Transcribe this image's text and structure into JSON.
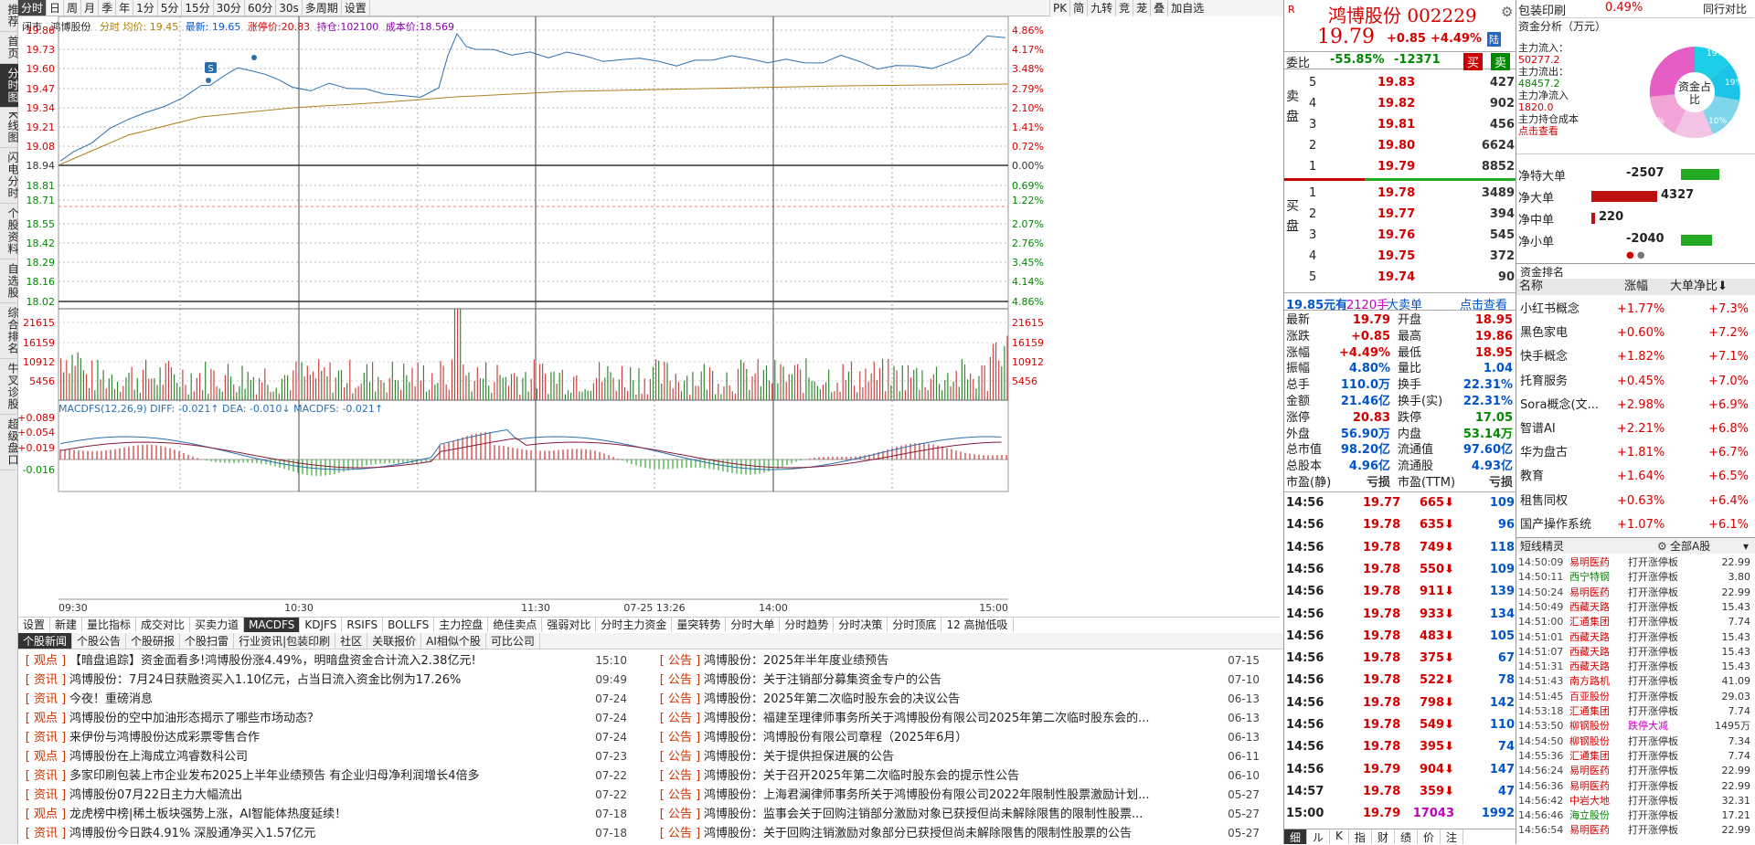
{
  "left_sidebar": [
    "推荐",
    "首页",
    "分时图",
    "K线图",
    "闪电分时",
    "个股资料",
    "自选股",
    "综合排名",
    "牛叉诊股",
    "超级盘口"
  ],
  "toolbar": [
    "分时",
    "日",
    "周",
    "月",
    "季",
    "年",
    "1分",
    "5分",
    "15分",
    "30分",
    "60分",
    "30s",
    "多周期",
    "设置"
  ],
  "toolbar_right": [
    "PK",
    "简",
    "九转",
    "竞",
    "茏",
    "叠",
    "加自选"
  ],
  "info": {
    "status": "闭市",
    "name": "鸿博股份",
    "avg": "分时 均价: 19.45",
    "latest": "最新: 19.65",
    "limit": "涨停价:20.83",
    "hold": "持仓:102100",
    "cost": "成本价:18.569"
  },
  "price_axis": {
    "left": [
      "19.86",
      "19.73",
      "19.60",
      "19.47",
      "19.34",
      "19.21",
      "19.08",
      "18.94",
      "18.81",
      "18.71",
      "18.55",
      "18.42",
      "18.29",
      "18.16",
      "18.02"
    ],
    "right": [
      "4.86%",
      "4.17%",
      "3.48%",
      "2.79%",
      "2.10%",
      "1.41%",
      "0.72%",
      "0.00%",
      "0.69%",
      "1.22%",
      "2.07%",
      "2.76%",
      "3.45%",
      "4.14%",
      "4.86%"
    ]
  },
  "volume_axis": [
    "21615",
    "16159",
    "10912",
    "5456"
  ],
  "macd": {
    "legend": "MACDFS(12,26,9) DIFF: -0.021↑ DEA: -0.010↓ MACDFS: -0.021↑",
    "ticks": [
      "+0.089",
      "+0.054",
      "+0.019",
      "-0.016"
    ]
  },
  "time_axis": [
    "09:30",
    "10:30",
    "11:30",
    "07-25 13:26",
    "14:00",
    "15:00"
  ],
  "badge": "S",
  "bottom_tabs": [
    "设置",
    "新建",
    "量比指标",
    "成交对比",
    "买卖力道",
    "MACDFS",
    "KDJFS",
    "RSIFS",
    "BOLLFS",
    "主力控盘",
    "绝佳卖点",
    "强弱对比",
    "分时主力资金",
    "量突转势",
    "分时大单",
    "分时趋势",
    "分时决策",
    "分时顶底",
    "12 高抛低吸"
  ],
  "news_tabs": [
    "个股新闻",
    "个股公告",
    "个股研报",
    "个股扫雷",
    "行业资讯|包装印刷",
    "社区",
    "关联报价",
    "AI相似个股",
    "可比公司"
  ],
  "news_left": [
    {
      "tag": "观点",
      "title": "【暗盘追踪】资金面看多!鸿博股份涨4.49%，明暗盘资金合计流入2.38亿元!",
      "date": "15:10"
    },
    {
      "tag": "资讯",
      "title": "鸿博股份：7月24日获融资买入1.10亿元，占当日流入资金比例为17.26%",
      "date": "09:49"
    },
    {
      "tag": "资讯",
      "title": "今夜！重磅消息",
      "date": "07-24"
    },
    {
      "tag": "观点",
      "title": "鸿博股份的空中加油形态揭示了哪些市场动态？",
      "date": "07-24"
    },
    {
      "tag": "资讯",
      "title": "来伊份与鸿博股份达成彩票零售合作",
      "date": "07-24"
    },
    {
      "tag": "观点",
      "title": "鸿博股份在上海成立鸿睿数科公司",
      "date": "07-23"
    },
    {
      "tag": "资讯",
      "title": "多家印刷包装上市企业发布2025上半年业绩预告 有企业归母净利润增长4倍多",
      "date": "07-22"
    },
    {
      "tag": "资讯",
      "title": "鸿博股份07月22日主力大幅流出",
      "date": "07-22"
    },
    {
      "tag": "观点",
      "title": "龙虎榜中榜|稀土板块强势上涨，AI智能体热度延续！",
      "date": "07-18"
    },
    {
      "tag": "资讯",
      "title": "鸿博股份今日跌4.91% 深股通净买入1.57亿元",
      "date": "07-18"
    }
  ],
  "news_right": [
    {
      "tag": "公告",
      "title": "鸿博股份：2025年半年度业绩预告",
      "date": "07-15"
    },
    {
      "tag": "公告",
      "title": "鸿博股份：关于注销部分募集资金专户的公告",
      "date": "07-10"
    },
    {
      "tag": "公告",
      "title": "鸿博股份：2025年第二次临时股东会的决议公告",
      "date": "06-13"
    },
    {
      "tag": "公告",
      "title": "鸿博股份：福建至理律师事务所关于鸿博股份有限公司2025年第二次临时股东会的...",
      "date": "06-13"
    },
    {
      "tag": "公告",
      "title": "鸿博股份：鸿博股份有限公司章程（2025年6月）",
      "date": "06-13"
    },
    {
      "tag": "公告",
      "title": "鸿博股份：关于提供担保进展的公告",
      "date": "06-11"
    },
    {
      "tag": "公告",
      "title": "鸿博股份：关于召开2025年第二次临时股东会的提示性公告",
      "date": "06-10"
    },
    {
      "tag": "公告",
      "title": "鸿博股份：上海君澜律师事务所关于鸿博股份有限公司2022年限制性股票激励计划...",
      "date": "05-27"
    },
    {
      "tag": "公告",
      "title": "鸿博股份：监事会关于回购注销部分激励对象已获授但尚未解除限售的限制性股票...",
      "date": "05-27"
    },
    {
      "tag": "公告",
      "title": "鸿博股份：关于回购注销激励对象部分已获授但尚未解除限售的限制性股票的公告",
      "date": "05-27"
    }
  ],
  "quote": {
    "r": "R",
    "name": "鸿博股份 002229",
    "price": "19.79",
    "change": "+0.85",
    "pct": "+4.49%",
    "lu": "陆",
    "weibi_label": "委比",
    "weibi": "-55.85%",
    "weicha": "-12371",
    "buy": "买",
    "sell": "卖",
    "sell_label": "卖盘",
    "buy_label": "买盘"
  },
  "asks": [
    {
      "l": "5",
      "p": "19.83",
      "v": "427"
    },
    {
      "l": "4",
      "p": "19.82",
      "v": "902"
    },
    {
      "l": "3",
      "p": "19.81",
      "v": "456"
    },
    {
      "l": "2",
      "p": "19.80",
      "v": "6624"
    },
    {
      "l": "1",
      "p": "19.79",
      "v": "8852"
    }
  ],
  "bids": [
    {
      "l": "1",
      "p": "19.78",
      "v": "3489"
    },
    {
      "l": "2",
      "p": "19.77",
      "v": "394"
    },
    {
      "l": "3",
      "p": "19.76",
      "v": "545"
    },
    {
      "l": "4",
      "p": "19.75",
      "v": "372"
    },
    {
      "l": "5",
      "p": "19.74",
      "v": "90"
    }
  ],
  "bigorder": {
    "price": "19.85元有",
    "hands": "2120手",
    "label": "大卖单",
    "link": "点击查看"
  },
  "stats": [
    [
      "最新",
      "19.79",
      "开盘",
      "18.95"
    ],
    [
      "涨跌",
      "+0.85",
      "最高",
      "19.86"
    ],
    [
      "涨幅",
      "+4.49%",
      "最低",
      "18.95"
    ],
    [
      "振幅",
      "4.80%",
      "量比",
      "1.04"
    ],
    [
      "总手",
      "110.0万",
      "换手",
      "22.31%"
    ],
    [
      "金额",
      "21.46亿",
      "换手(实)",
      "22.31%"
    ],
    [
      "涨停",
      "20.83",
      "跌停",
      "17.05"
    ],
    [
      "外盘",
      "56.90万",
      "内盘",
      "53.14万"
    ],
    [
      "总市值",
      "98.20亿",
      "流通值",
      "97.60亿"
    ],
    [
      "总股本",
      "4.96亿",
      "流通股",
      "4.93亿"
    ],
    [
      "市盈(静)",
      "亏损",
      "市盈(TTM)",
      "亏损"
    ]
  ],
  "ticks": [
    [
      "14:56",
      "19.77",
      "665",
      "109"
    ],
    [
      "14:56",
      "19.78",
      "635",
      "96"
    ],
    [
      "14:56",
      "19.78",
      "749",
      "118"
    ],
    [
      "14:56",
      "19.78",
      "550",
      "109"
    ],
    [
      "14:56",
      "19.78",
      "911",
      "139"
    ],
    [
      "14:56",
      "19.78",
      "933",
      "134"
    ],
    [
      "14:56",
      "19.78",
      "483",
      "105"
    ],
    [
      "14:56",
      "19.78",
      "375",
      "67"
    ],
    [
      "14:56",
      "19.78",
      "522",
      "78"
    ],
    [
      "14:56",
      "19.78",
      "798",
      "142"
    ],
    [
      "14:56",
      "19.78",
      "549",
      "110"
    ],
    [
      "14:56",
      "19.78",
      "395",
      "74"
    ],
    [
      "14:56",
      "19.79",
      "904",
      "147"
    ],
    [
      "14:57",
      "19.78",
      "359",
      "47"
    ],
    [
      "15:00",
      "19.79",
      "17043",
      "1992"
    ]
  ],
  "tick_tabs": [
    "细",
    "ル",
    "K",
    "指",
    "财",
    "绩",
    "价",
    "注"
  ],
  "fund": {
    "industry": "包装印刷",
    "industry_pct": "0.49%",
    "peer": "同行对比",
    "title": "资金分析（万元）",
    "in_label": "主力流入：",
    "in": "50277.2",
    "out_label": "主力流出：",
    "out": "48457.2",
    "net_label": "主力净流入",
    "net": "1820.0",
    "cost_label": "主力持仓成本",
    "cost_link": "点击查看",
    "pie_center": "资金占比",
    "pie": [
      "8%",
      "19%",
      "19%",
      "10%",
      "10%",
      "8%"
    ],
    "flows": [
      {
        "label": "净特大单",
        "value": "-2507",
        "color": "#22aa22",
        "w": 0.35
      },
      {
        "label": "净大单",
        "value": "4327",
        "color": "#bb1111",
        "w": 0.6
      },
      {
        "label": "净中单",
        "value": "220",
        "color": "#bb1111",
        "w": 0.03
      },
      {
        "label": "净小单",
        "value": "-2040",
        "color": "#22aa22",
        "w": 0.28
      }
    ]
  },
  "rank": {
    "title": "资金排名",
    "h1": "名称",
    "h2": "涨幅",
    "h3": "大单净比",
    "rows": [
      [
        "小红书概念",
        "+1.77%",
        "+7.3%"
      ],
      [
        "黑色家电",
        "+0.60%",
        "+7.2%"
      ],
      [
        "快手概念",
        "+1.82%",
        "+7.1%"
      ],
      [
        "托育服务",
        "+0.45%",
        "+7.0%"
      ],
      [
        "Sora概念(文...",
        "+2.98%",
        "+6.9%"
      ],
      [
        "智谱AI",
        "+2.21%",
        "+6.8%"
      ],
      [
        "华为盘古",
        "+1.81%",
        "+6.7%"
      ],
      [
        "教育",
        "+1.64%",
        "+6.5%"
      ],
      [
        "租售同权",
        "+0.63%",
        "+6.4%"
      ],
      [
        "国产操作系统",
        "+1.07%",
        "+6.1%"
      ]
    ]
  },
  "sprite": {
    "title": "短线精灵",
    "market": "全部A股",
    "rows": [
      [
        "14:50:09",
        "易明医药",
        "打开涨停板",
        "22.99"
      ],
      [
        "14:50:11",
        "西宁特钢",
        "打开涨停板",
        "3.80"
      ],
      [
        "14:50:24",
        "易明医药",
        "打开涨停板",
        "22.99"
      ],
      [
        "14:50:49",
        "西藏天路",
        "打开涨停板",
        "15.43"
      ],
      [
        "14:51:00",
        "汇通集团",
        "打开涨停板",
        "7.74"
      ],
      [
        "14:51:01",
        "西藏天路",
        "打开涨停板",
        "15.43"
      ],
      [
        "14:51:07",
        "西藏天路",
        "打开涨停板",
        "15.43"
      ],
      [
        "14:51:31",
        "西藏天路",
        "打开涨停板",
        "15.43"
      ],
      [
        "14:51:43",
        "南方路机",
        "打开涨停板",
        "41.09"
      ],
      [
        "14:51:45",
        "百亚股份",
        "打开涨停板",
        "29.03"
      ],
      [
        "14:53:18",
        "汇通集团",
        "打开涨停板",
        "7.74"
      ],
      [
        "14:53:50",
        "柳钢股份",
        "跌停大减",
        "1495万"
      ],
      [
        "14:54:50",
        "柳钢股份",
        "打开涨停板",
        "7.34"
      ],
      [
        "14:55:36",
        "汇通集团",
        "打开涨停板",
        "7.74"
      ],
      [
        "14:56:24",
        "易明医药",
        "打开涨停板",
        "22.99"
      ],
      [
        "14:56:36",
        "易明医药",
        "打开涨停板",
        "22.99"
      ],
      [
        "14:56:42",
        "中岩大地",
        "打开涨停板",
        "32.31"
      ],
      [
        "14:56:46",
        "海立股份",
        "打开涨停板",
        "17.21"
      ],
      [
        "14:56:54",
        "易明医药",
        "打开涨停板",
        "22.99"
      ]
    ]
  }
}
